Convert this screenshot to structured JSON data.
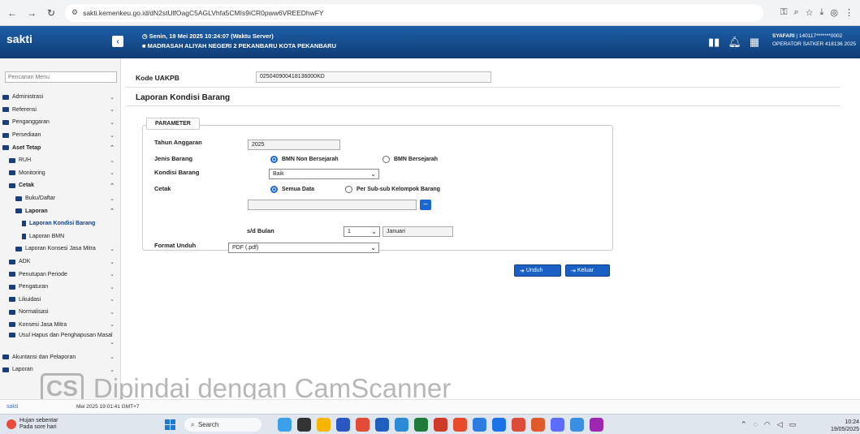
{
  "browser": {
    "url": "sakti.kemenkeu.go.id/dN2stUlfOagC5AGLVhfa5CMIs9iCR0pww6VREEDhwFY"
  },
  "header": {
    "logo": "sakti",
    "datetime": "Senin, 19 Mei 2025 10:24:07 (Waktu Server)",
    "organization": "MADRASAH ALIYAH NEGERI 2 PEKANBARU KOTA PEKANBARU",
    "user_name": "SYAFARI",
    "user_id": "| 140117*******0002",
    "user_role": "OPERATOR SATKER 418136 2025"
  },
  "sidebar": {
    "search_placeholder": "Pencarian Menu",
    "items": [
      {
        "label": "Administrasi",
        "indent": 0,
        "icon": "folder-icon",
        "chevron": "⌄"
      },
      {
        "label": "Referensi",
        "indent": 0,
        "icon": "folder-icon",
        "chevron": "⌄"
      },
      {
        "label": "Penganggaran",
        "indent": 0,
        "icon": "folder-icon",
        "chevron": "⌄"
      },
      {
        "label": "Persediaan",
        "indent": 0,
        "icon": "folder-icon",
        "chevron": "⌄"
      },
      {
        "label": "Aset Tetap",
        "indent": 0,
        "icon": "folder-icon",
        "chevron": "⌃",
        "bold": true
      },
      {
        "label": "RUH",
        "indent": 1,
        "icon": "folder-icon",
        "chevron": "⌄"
      },
      {
        "label": "Monitoring",
        "indent": 1,
        "icon": "folder-icon",
        "chevron": "⌄"
      },
      {
        "label": "Cetak",
        "indent": 1,
        "icon": "folder-icon",
        "chevron": "⌃",
        "bold": true
      },
      {
        "label": "Buku/Daftar",
        "indent": 2,
        "icon": "folder-icon",
        "chevron": "⌄"
      },
      {
        "label": "Laporan",
        "indent": 2,
        "icon": "folder-icon",
        "chevron": "⌃",
        "bold": true
      },
      {
        "label": "Laporan Kondisi Barang",
        "indent": 3,
        "icon": "doc-icon",
        "chevron": "",
        "active": true
      },
      {
        "label": "Laporan BMN",
        "indent": 3,
        "icon": "doc-icon",
        "chevron": ""
      },
      {
        "label": "Laporan Konsesi Jasa Mitra",
        "indent": 2,
        "icon": "folder-icon",
        "chevron": "⌄"
      },
      {
        "label": "ADK",
        "indent": 1,
        "icon": "folder-icon",
        "chevron": "⌄"
      },
      {
        "label": "Penutupan Periode",
        "indent": 1,
        "icon": "folder-icon",
        "chevron": "⌄"
      },
      {
        "label": "Pengaturan",
        "indent": 1,
        "icon": "folder-icon",
        "chevron": "⌄"
      },
      {
        "label": "Likuidasi",
        "indent": 1,
        "icon": "folder-icon",
        "chevron": "⌄"
      },
      {
        "label": "Normalisasi",
        "indent": 1,
        "icon": "folder-icon",
        "chevron": "⌄"
      },
      {
        "label": "Konsesi Jasa Mitra",
        "indent": 1,
        "icon": "folder-icon",
        "chevron": "⌄"
      },
      {
        "label": "Usul Hapus dan Penghapusan Masal",
        "indent": 1,
        "icon": "folder-icon",
        "chevron": "⌄",
        "double": true
      },
      {
        "label": "Akuntansi dan Pelaporan",
        "indent": 0,
        "icon": "folder-icon",
        "chevron": "⌄"
      },
      {
        "label": "Laporan",
        "indent": 0,
        "icon": "folder-icon",
        "chevron": "⌄"
      }
    ]
  },
  "main": {
    "kode_label": "Kode UAKPB",
    "kode_value": "025040900418136000KD",
    "title": "Laporan Kondisi Barang",
    "param_legend": "PARAMETER",
    "tahun_label": "Tahun Anggaran",
    "tahun_value": "2025",
    "jenis_label": "Jenis Barang",
    "jenis_opt1": "BMN Non Bersejarah",
    "jenis_opt2": "BMN Bersejarah",
    "kondisi_label": "Kondisi Barang",
    "kondisi_value": "Baik",
    "cetak_label": "Cetak",
    "cetak_opt1": "Semua Data",
    "cetak_opt2": "Per Sub-sub Kelompok Barang",
    "bulan_label": "s/d Bulan",
    "bulan_num": "1",
    "bulan_name": "Januari",
    "format_label": "Format Unduh",
    "format_value": "PDF (.pdf)",
    "unduh_label": "Unduh",
    "keluar_label": "Keluar"
  },
  "status_bar": {
    "logo": "sakti",
    "time": "Mei 2025 19:01:41 GMT+7"
  },
  "watermark": {
    "badge": "CS",
    "text": "Dipindai dengan CamScanner"
  },
  "taskbar": {
    "weather_line1": "Hujan sebentar",
    "weather_line2": "Pada sore hari",
    "search_label": "Search",
    "time": "10:24",
    "date": "19/05/2025",
    "app_colors": [
      "#3aa0e8",
      "#333333",
      "#f6b500",
      "#2b57c4",
      "#e24c36",
      "#1f5fbf",
      "#2b8bd6",
      "#1e7b3a",
      "#cf3b2b",
      "#e94b2a",
      "#2d7de0",
      "#1a73e8",
      "#dd4b39",
      "#e05a2c",
      "#5b6cff",
      "#3b8fe3",
      "#9c27b0"
    ]
  }
}
